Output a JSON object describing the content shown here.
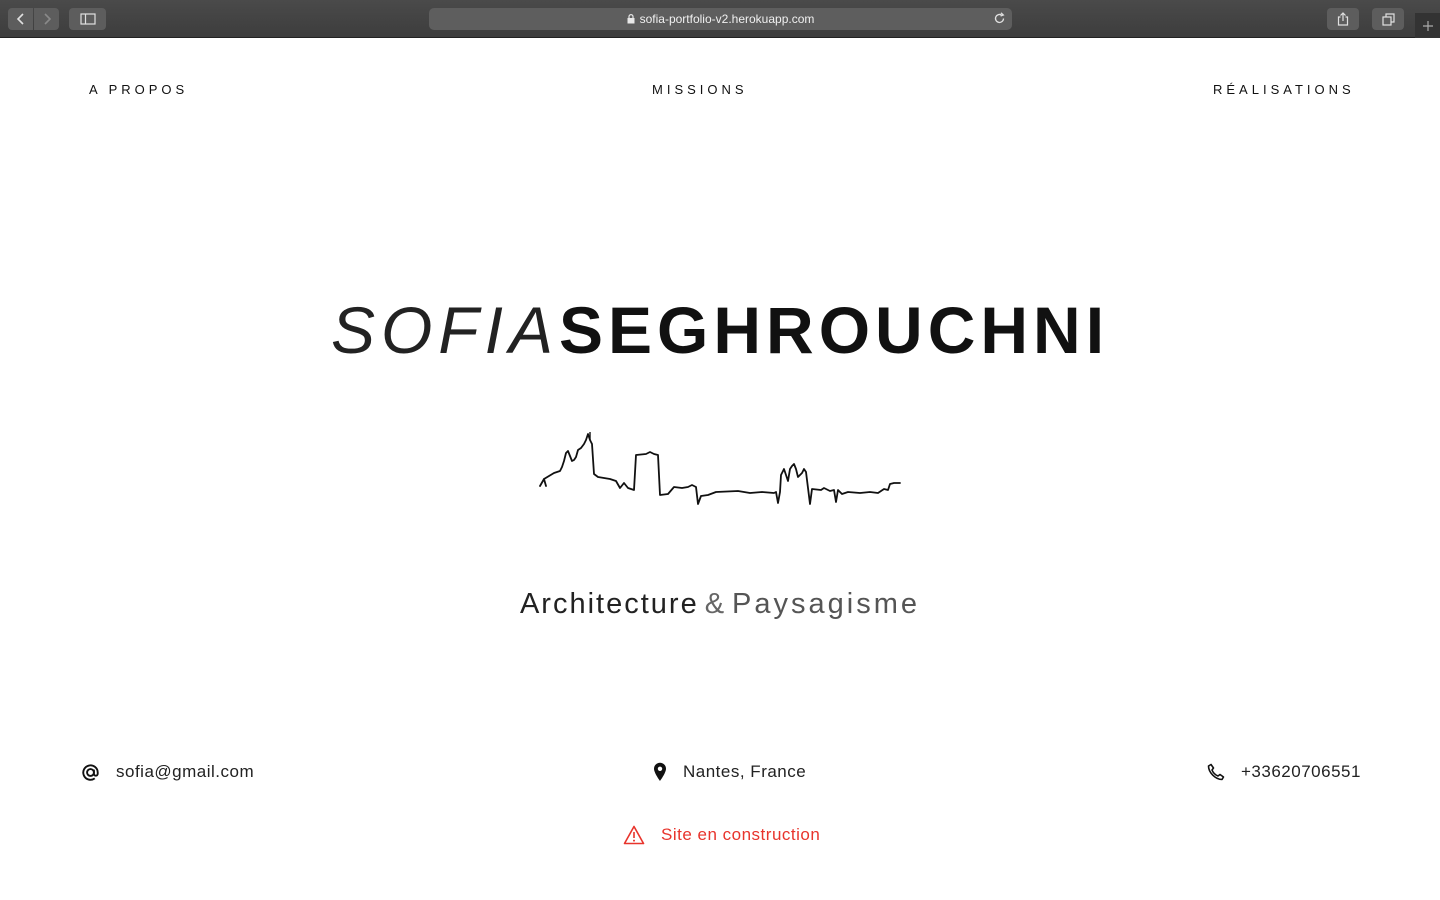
{
  "browser": {
    "url": "sofia-portfolio-v2.herokuapp.com"
  },
  "nav": {
    "about": "A PROPOS",
    "missions": "MISSIONS",
    "realisations": "RÉALISATIONS"
  },
  "hero": {
    "first_name": "SOFIA",
    "last_name": "SEGHROUCHNI",
    "tagline_part1": "Architecture",
    "tagline_amp": "&",
    "tagline_part2": "Paysagisme"
  },
  "contact": {
    "email": "sofia@gmail.com",
    "location": "Nantes, France",
    "phone": "+33620706551"
  },
  "notice": {
    "text": "Site en construction",
    "color": "#e8342c"
  },
  "icons": {
    "back": "chevron-left-icon",
    "forward": "chevron-right-icon",
    "sidebar": "sidebar-icon",
    "lock": "lock-icon",
    "reload": "reload-icon",
    "share": "share-icon",
    "tabs": "tabs-icon",
    "email": "at-sign-icon",
    "location": "map-pin-icon",
    "phone": "phone-icon",
    "warning": "warning-triangle-icon"
  }
}
